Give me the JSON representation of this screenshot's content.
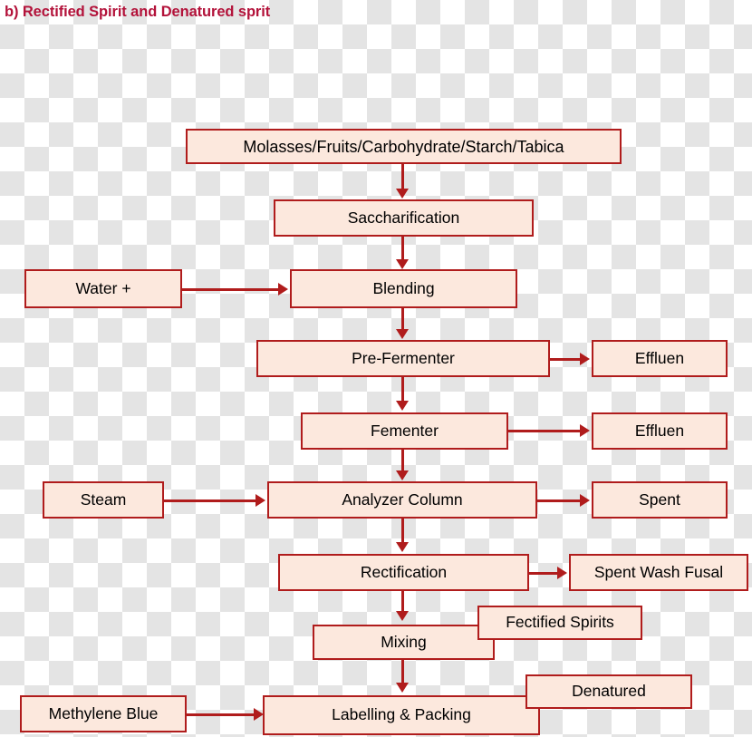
{
  "title": "b) Rectified Spirit and Denatured sprit",
  "colors": {
    "box_fill": "#fce8dd",
    "box_border": "#b01c1c",
    "title_text": "#b3123a",
    "node_text": "#000000",
    "checker_light": "#ffffff",
    "checker_dark": "#e4e4e4"
  },
  "nodes": {
    "feedstock": "Molasses/Fruits/Carbohydrate/Starch/Tabica",
    "saccharification": "Saccharification",
    "water": "Water +",
    "blending": "Blending",
    "pre_fermenter": "Pre-Fermenter",
    "effluent_1": "Effluen",
    "fementer": "Fementer",
    "effluent_2": "Effluen",
    "steam": "Steam",
    "analyzer_column": "Analyzer Column",
    "spent": "Spent",
    "rectification": "Rectification",
    "spent_wash_fusal": "Spent Wash Fusal",
    "mixing": "Mixing",
    "fectified_spirits": "Fectified Spirits",
    "denatured": "Denatured",
    "methylene_blue": "Methylene Blue",
    "labelling_packing": "Labelling & Packing"
  },
  "flow": {
    "main_chain": [
      "Molasses/Fruits/Carbohydrate/Starch/Tabica",
      "Saccharification",
      "Blending",
      "Pre-Fermenter",
      "Fementer",
      "Analyzer Column",
      "Rectification",
      "Mixing",
      "Labelling & Packing"
    ],
    "inputs": [
      {
        "from": "Water +",
        "to": "Blending"
      },
      {
        "from": "Steam",
        "to": "Analyzer Column"
      },
      {
        "from": "Methylene Blue",
        "to": "Labelling & Packing"
      }
    ],
    "outputs": [
      {
        "from": "Pre-Fermenter",
        "to": "Effluen"
      },
      {
        "from": "Fementer",
        "to": "Effluen"
      },
      {
        "from": "Analyzer Column",
        "to": "Spent"
      },
      {
        "from": "Rectification",
        "to": "Spent Wash Fusal"
      }
    ],
    "labels": [
      "Fectified Spirits",
      "Denatured"
    ]
  }
}
